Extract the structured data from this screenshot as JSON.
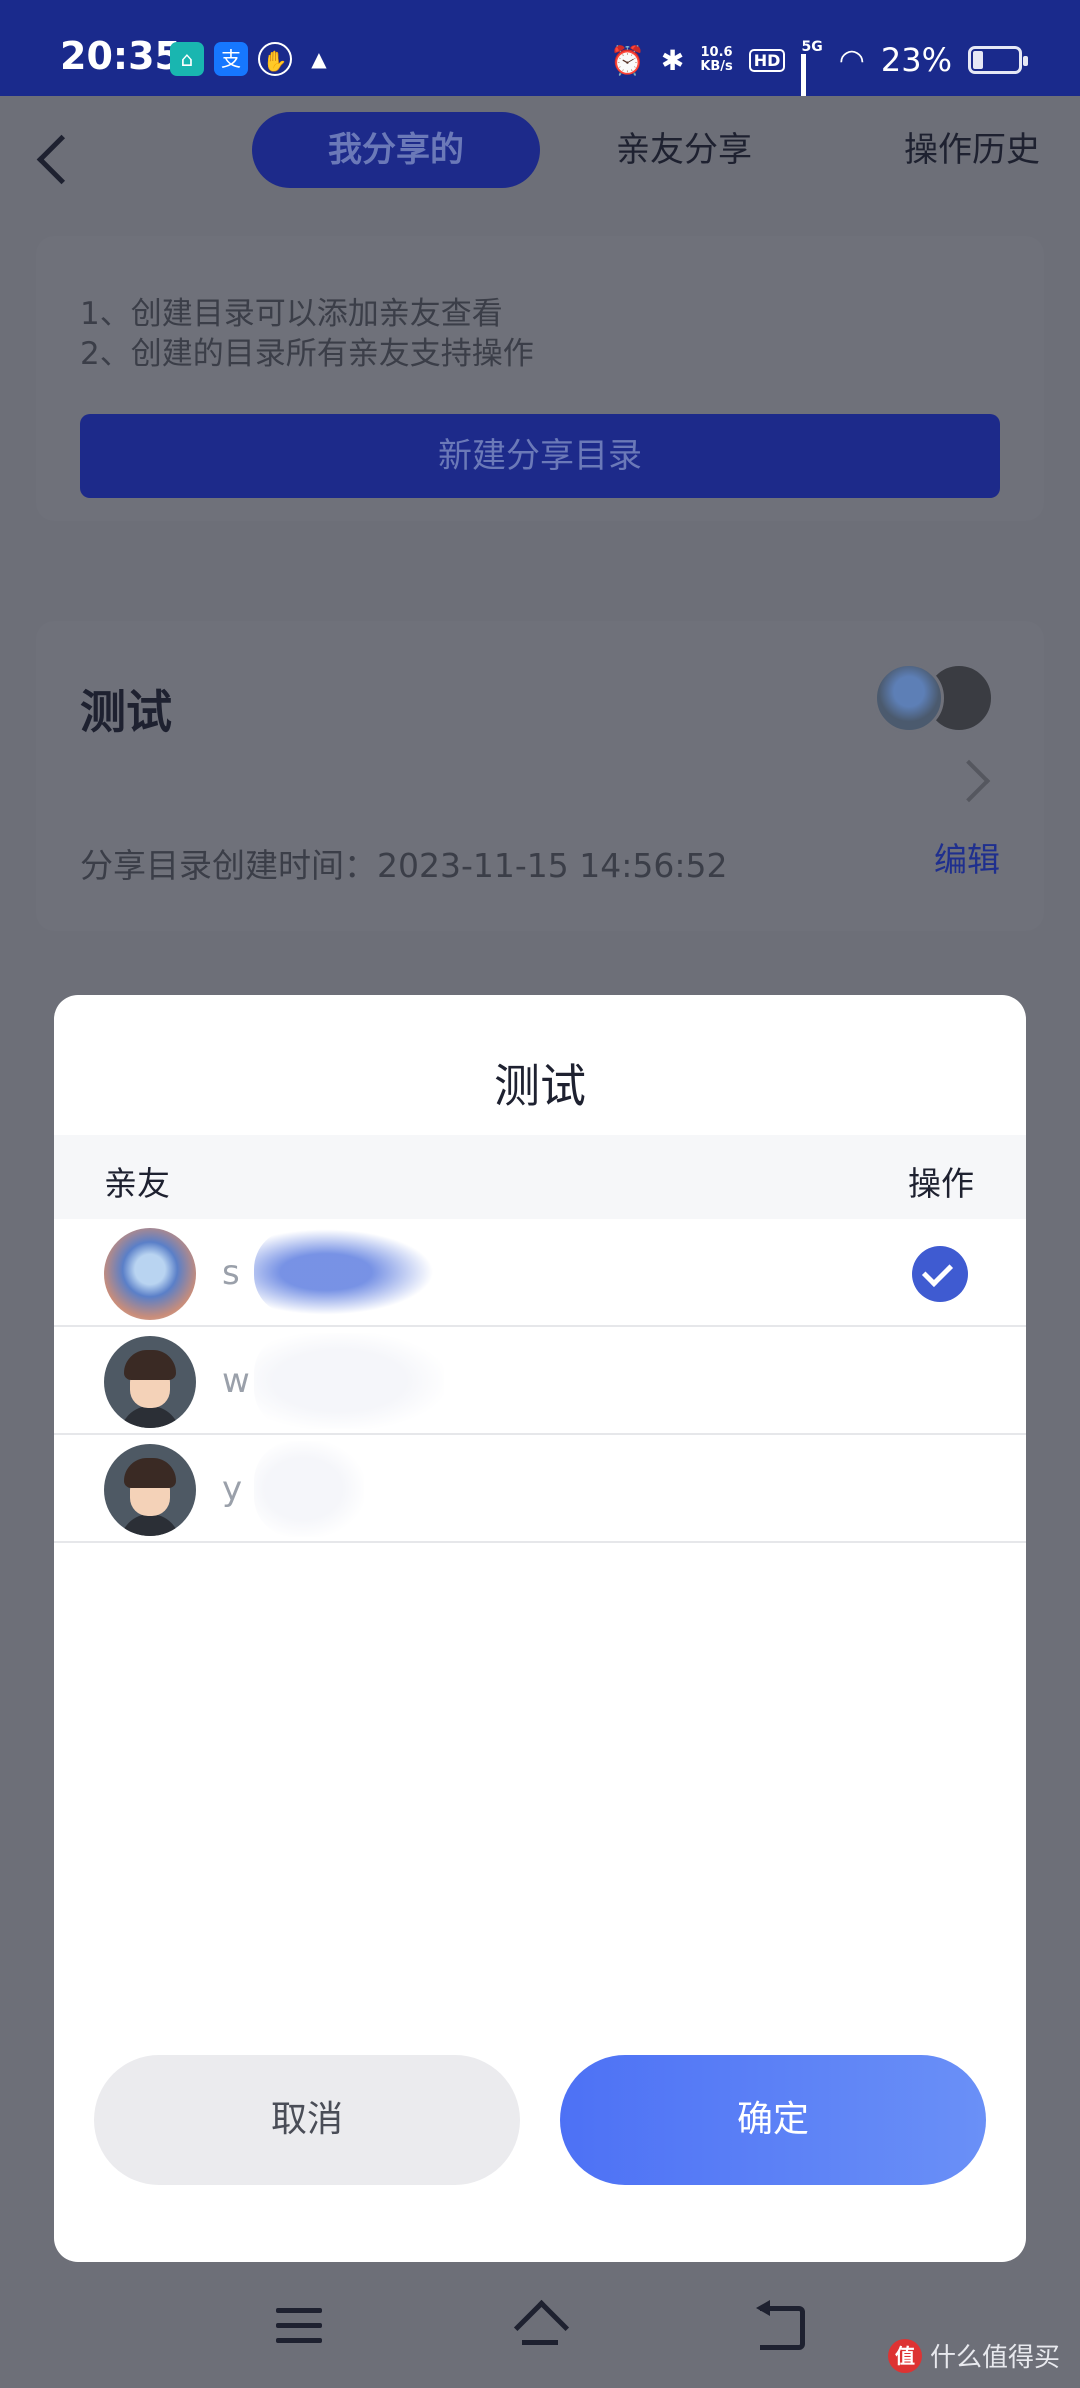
{
  "status_bar": {
    "time": "20:35",
    "net_speed_value": "10.6",
    "net_speed_unit": "KB/s",
    "hd": "HD",
    "network": "5G",
    "battery": "23%",
    "battery_level": 0.23
  },
  "tabs": {
    "mine": "我分享的",
    "friends": "亲友分享",
    "history": "操作历史"
  },
  "notice": {
    "line1": "1、创建目录可以添加亲友查看",
    "line2": "2、创建的目录所有亲友支持操作",
    "create_button": "新建分享目录"
  },
  "directory": {
    "title": "测试",
    "created_time": "分享目录创建时间：2023-11-15 14:56:52",
    "edit": "编辑"
  },
  "modal": {
    "title": "测试",
    "col_friend": "亲友",
    "col_action": "操作",
    "friends": [
      {
        "name": "s",
        "checked": true
      },
      {
        "name": "w",
        "checked": false
      },
      {
        "name": "y",
        "checked": false
      }
    ],
    "cancel": "取消",
    "confirm": "确定"
  },
  "watermark": "什么值得买",
  "colors": {
    "status_bar_bg": "#1a2a8c",
    "overlay_bg": "#6d6f78",
    "accent_blue": "#4d71f5"
  }
}
